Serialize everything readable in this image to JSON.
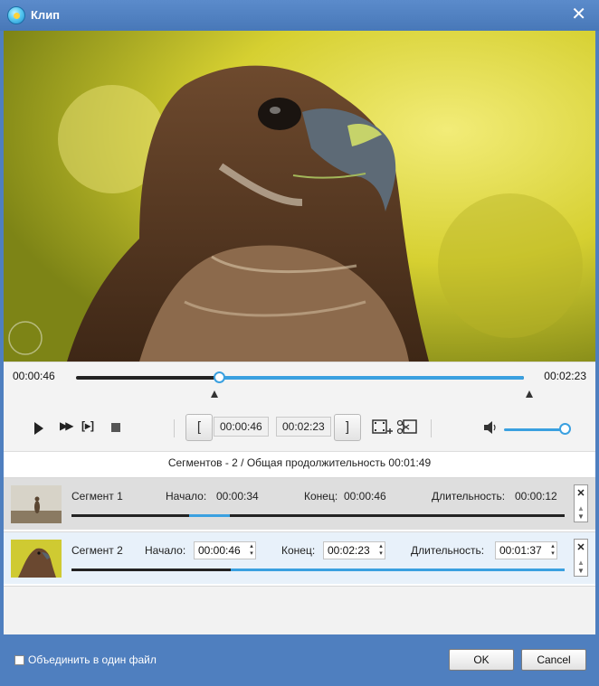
{
  "window": {
    "title": "Клип",
    "close_icon": "close-icon"
  },
  "timeline": {
    "current_time": "00:00:46",
    "total_time": "00:02:23",
    "progress_fraction": 0.32
  },
  "controls": {
    "play_icon": "play-icon",
    "fast_forward_icon": "fast-forward-icon",
    "play_segment_label": "[▸]",
    "stop_icon": "stop-icon",
    "set_start_label": "[",
    "start_time": "00:00:46",
    "end_time": "00:02:23",
    "set_end_label": "]",
    "add_segment_icon": "film-plus-icon",
    "cut_icon": "scissors-film-icon",
    "volume_icon": "volume-icon",
    "volume_fraction": 1.0
  },
  "summary": {
    "text": "Сегментов - 2 / Общая продолжительность 00:01:49"
  },
  "segments": [
    {
      "name": "Сегмент 1",
      "start_label": "Начало:",
      "start": "00:00:34",
      "end_label": "Конец:",
      "end": "00:00:46",
      "duration_label": "Длительность:",
      "duration": "00:00:12",
      "selected": false
    },
    {
      "name": "Сегмент 2",
      "start_label": "Начало:",
      "start": "00:00:46",
      "end_label": "Конец:",
      "end": "00:02:23",
      "duration_label": "Длительность:",
      "duration": "00:01:37",
      "selected": true
    }
  ],
  "footer": {
    "merge_label": "Объединить в один файл",
    "merge_checked": false,
    "ok_label": "OK",
    "cancel_label": "Cancel"
  },
  "colors": {
    "accent": "#3aa0e0",
    "window_frame": "#4f7fbf"
  }
}
